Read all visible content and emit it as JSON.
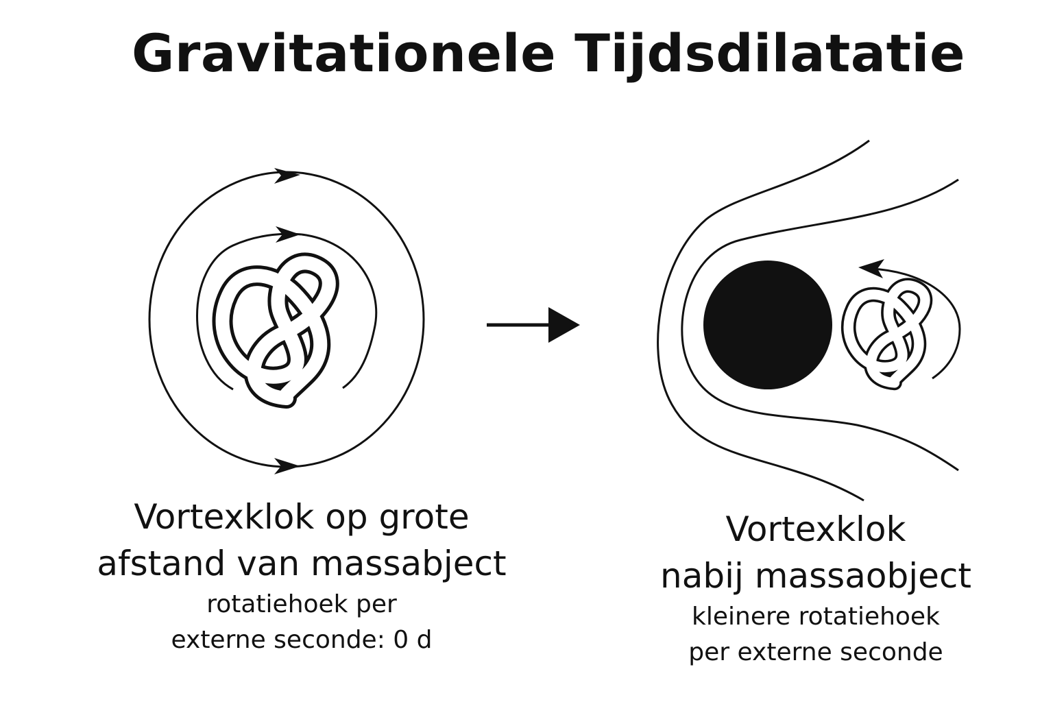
{
  "title": "Gravitationele Tijdsdilatatie",
  "left_panel": {
    "heading_line1": "Vortexklok op grote",
    "heading_line2": "afstand van massabject",
    "sub_line1": "rotatiehoek per",
    "sub_line2": "externe seconde: 0 d",
    "icons": [
      "trefoil-knot-icon",
      "flow-circle-icon",
      "arrow-icon"
    ]
  },
  "transition": {
    "icon": "right-arrow-icon"
  },
  "right_panel": {
    "heading_line1": "Vortexklok",
    "heading_line2": "nabij massaobject",
    "sub_line1": "kleinere rotatiehoek",
    "sub_line2": "per externe seconde",
    "icons": [
      "black-hole-icon",
      "trefoil-knot-icon",
      "curved-arrow-icon"
    ]
  },
  "colors": {
    "ink": "#111111",
    "background": "#ffffff"
  }
}
